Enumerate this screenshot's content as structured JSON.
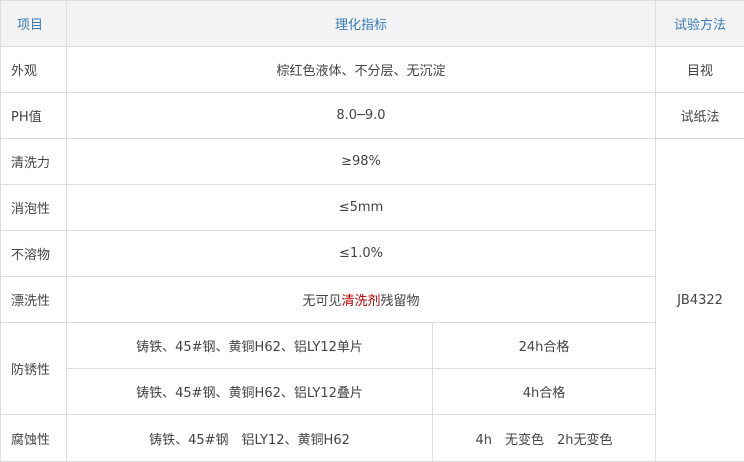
{
  "table": {
    "headers": {
      "item": "项目",
      "spec": "理化指标",
      "method": "试验方法"
    },
    "rows": {
      "appearance": {
        "item": "外观",
        "spec": "棕红色液体、不分层、无沉淀",
        "method": "目视"
      },
      "ph": {
        "item": "PH值",
        "spec": "8.0─9.0",
        "method": "试纸法"
      },
      "cleaning": {
        "item": "清洗力",
        "spec": "≥98%"
      },
      "foaming": {
        "item": "消泡性",
        "spec": "≤5mm"
      },
      "insoluble": {
        "item": "不溶物",
        "spec": "≤1.0%"
      },
      "rinsing": {
        "item": "漂洗性",
        "spec_before": "无可见",
        "spec_highlight": "清洗剂",
        "spec_after": "残留物"
      },
      "rust": {
        "item": "防锈性",
        "sub1_material": "铸铁、45#钢、黄铜H62、铝LY12单片",
        "sub1_result": "24h合格",
        "sub2_material": "铸铁、45#钢、黄铜H62、铝LY12叠片",
        "sub2_result": "4h合格"
      },
      "corrosion": {
        "item": "腐蚀性",
        "material": "铸铁、45#钢　铝LY12、黄铜H62",
        "result": "4h　无变色　2h无变色"
      }
    },
    "shared_method": "JB4322"
  },
  "colors": {
    "header_text": "#3a7bb8",
    "header_bg": "#f3f3f3",
    "highlight_text": "#b30000",
    "border": "#dcdcdc"
  }
}
